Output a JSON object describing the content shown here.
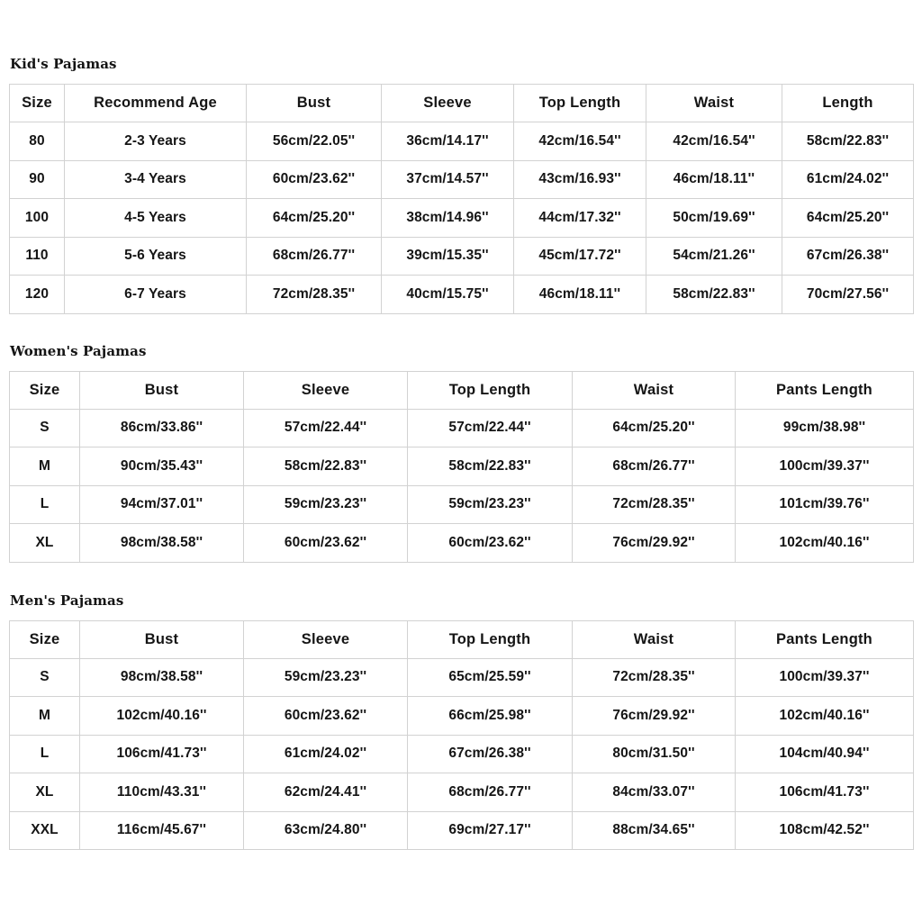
{
  "sections": [
    {
      "id": "kids",
      "title": "Kid's Pajamas",
      "columns": [
        "Size",
        "Recommend Age",
        "Bust",
        "Sleeve",
        "Top Length",
        "Waist",
        "Length"
      ],
      "rows": [
        [
          "80",
          "2-3 Years",
          "56cm/22.05''",
          "36cm/14.17''",
          "42cm/16.54''",
          "42cm/16.54''",
          "58cm/22.83''"
        ],
        [
          "90",
          "3-4 Years",
          "60cm/23.62''",
          "37cm/14.57''",
          "43cm/16.93''",
          "46cm/18.11''",
          "61cm/24.02''"
        ],
        [
          "100",
          "4-5 Years",
          "64cm/25.20''",
          "38cm/14.96''",
          "44cm/17.32''",
          "50cm/19.69''",
          "64cm/25.20''"
        ],
        [
          "110",
          "5-6 Years",
          "68cm/26.77''",
          "39cm/15.35''",
          "45cm/17.72''",
          "54cm/21.26''",
          "67cm/26.38''"
        ],
        [
          "120",
          "6-7 Years",
          "72cm/28.35''",
          "40cm/15.75''",
          "46cm/18.11''",
          "58cm/22.83''",
          "70cm/27.56''"
        ]
      ]
    },
    {
      "id": "women",
      "title": "Women's Pajamas",
      "columns": [
        "Size",
        "Bust",
        "Sleeve",
        "Top Length",
        "Waist",
        "Pants Length"
      ],
      "rows": [
        [
          "S",
          "86cm/33.86''",
          "57cm/22.44''",
          "57cm/22.44''",
          "64cm/25.20''",
          "99cm/38.98''"
        ],
        [
          "M",
          "90cm/35.43''",
          "58cm/22.83''",
          "58cm/22.83''",
          "68cm/26.77''",
          "100cm/39.37''"
        ],
        [
          "L",
          "94cm/37.01''",
          "59cm/23.23''",
          "59cm/23.23''",
          "72cm/28.35''",
          "101cm/39.76''"
        ],
        [
          "XL",
          "98cm/38.58''",
          "60cm/23.62''",
          "60cm/23.62''",
          "76cm/29.92''",
          "102cm/40.16''"
        ]
      ]
    },
    {
      "id": "men",
      "title": "Men's Pajamas",
      "columns": [
        "Size",
        "Bust",
        "Sleeve",
        "Top Length",
        "Waist",
        "Pants Length"
      ],
      "rows": [
        [
          "S",
          "98cm/38.58''",
          "59cm/23.23''",
          "65cm/25.59''",
          "72cm/28.35''",
          "100cm/39.37''"
        ],
        [
          "M",
          "102cm/40.16''",
          "60cm/23.62''",
          "66cm/25.98''",
          "76cm/29.92''",
          "102cm/40.16''"
        ],
        [
          "L",
          "106cm/41.73''",
          "61cm/24.02''",
          "67cm/26.38''",
          "80cm/31.50''",
          "104cm/40.94''"
        ],
        [
          "XL",
          "110cm/43.31''",
          "62cm/24.41''",
          "68cm/26.77''",
          "84cm/33.07''",
          "106cm/41.73''"
        ],
        [
          "XXL",
          "116cm/45.67''",
          "63cm/24.80''",
          "69cm/27.17''",
          "88cm/34.65''",
          "108cm/42.52''"
        ]
      ]
    }
  ],
  "colors": {
    "background": "#ffffff",
    "text": "#151515",
    "border": "#d2d2d2",
    "outer_border": "#c9c9c9"
  }
}
